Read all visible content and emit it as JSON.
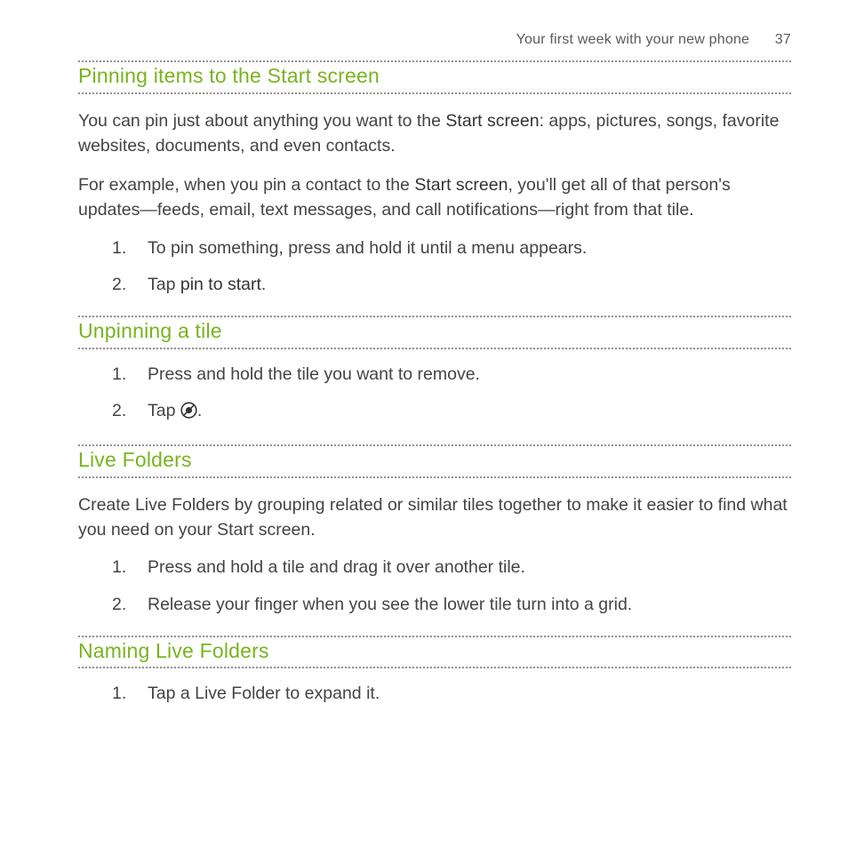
{
  "header": {
    "title": "Your first week with your new phone",
    "page_number": "37"
  },
  "sections": [
    {
      "heading": "Pinning items to the Start screen",
      "paragraphs": [
        {
          "pre": "You can pin just about anything you want to the ",
          "bold": "Start screen",
          "post": ": apps, pictures, songs, favorite websites, documents, and even contacts."
        },
        {
          "pre": "For example, when you pin a contact to the ",
          "bold": "Start screen",
          "post": ", you'll get all of that person's updates—feeds, email, text messages, and call notifications—right from that tile."
        }
      ],
      "steps": [
        {
          "text": "To pin something, press and hold it until a menu appears."
        },
        {
          "pre": "Tap ",
          "bold": "pin to start",
          "post": "."
        }
      ]
    },
    {
      "heading": "Unpinning a tile",
      "paragraphs": [],
      "steps": [
        {
          "text": "Press and hold the tile you want to remove."
        },
        {
          "pre": "Tap ",
          "icon": "unpin-icon",
          "post": "."
        }
      ]
    },
    {
      "heading": "Live Folders",
      "paragraphs": [
        {
          "text": "Create Live Folders by grouping related or similar tiles together to make it easier to find what you need on your Start screen."
        }
      ],
      "steps": [
        {
          "text": "Press and hold a tile and drag it over another tile."
        },
        {
          "text": "Release your finger when you see the lower tile turn into a grid."
        }
      ]
    },
    {
      "heading": "Naming Live Folders",
      "paragraphs": [],
      "steps": [
        {
          "text": "Tap a Live Folder to expand it."
        }
      ]
    }
  ]
}
